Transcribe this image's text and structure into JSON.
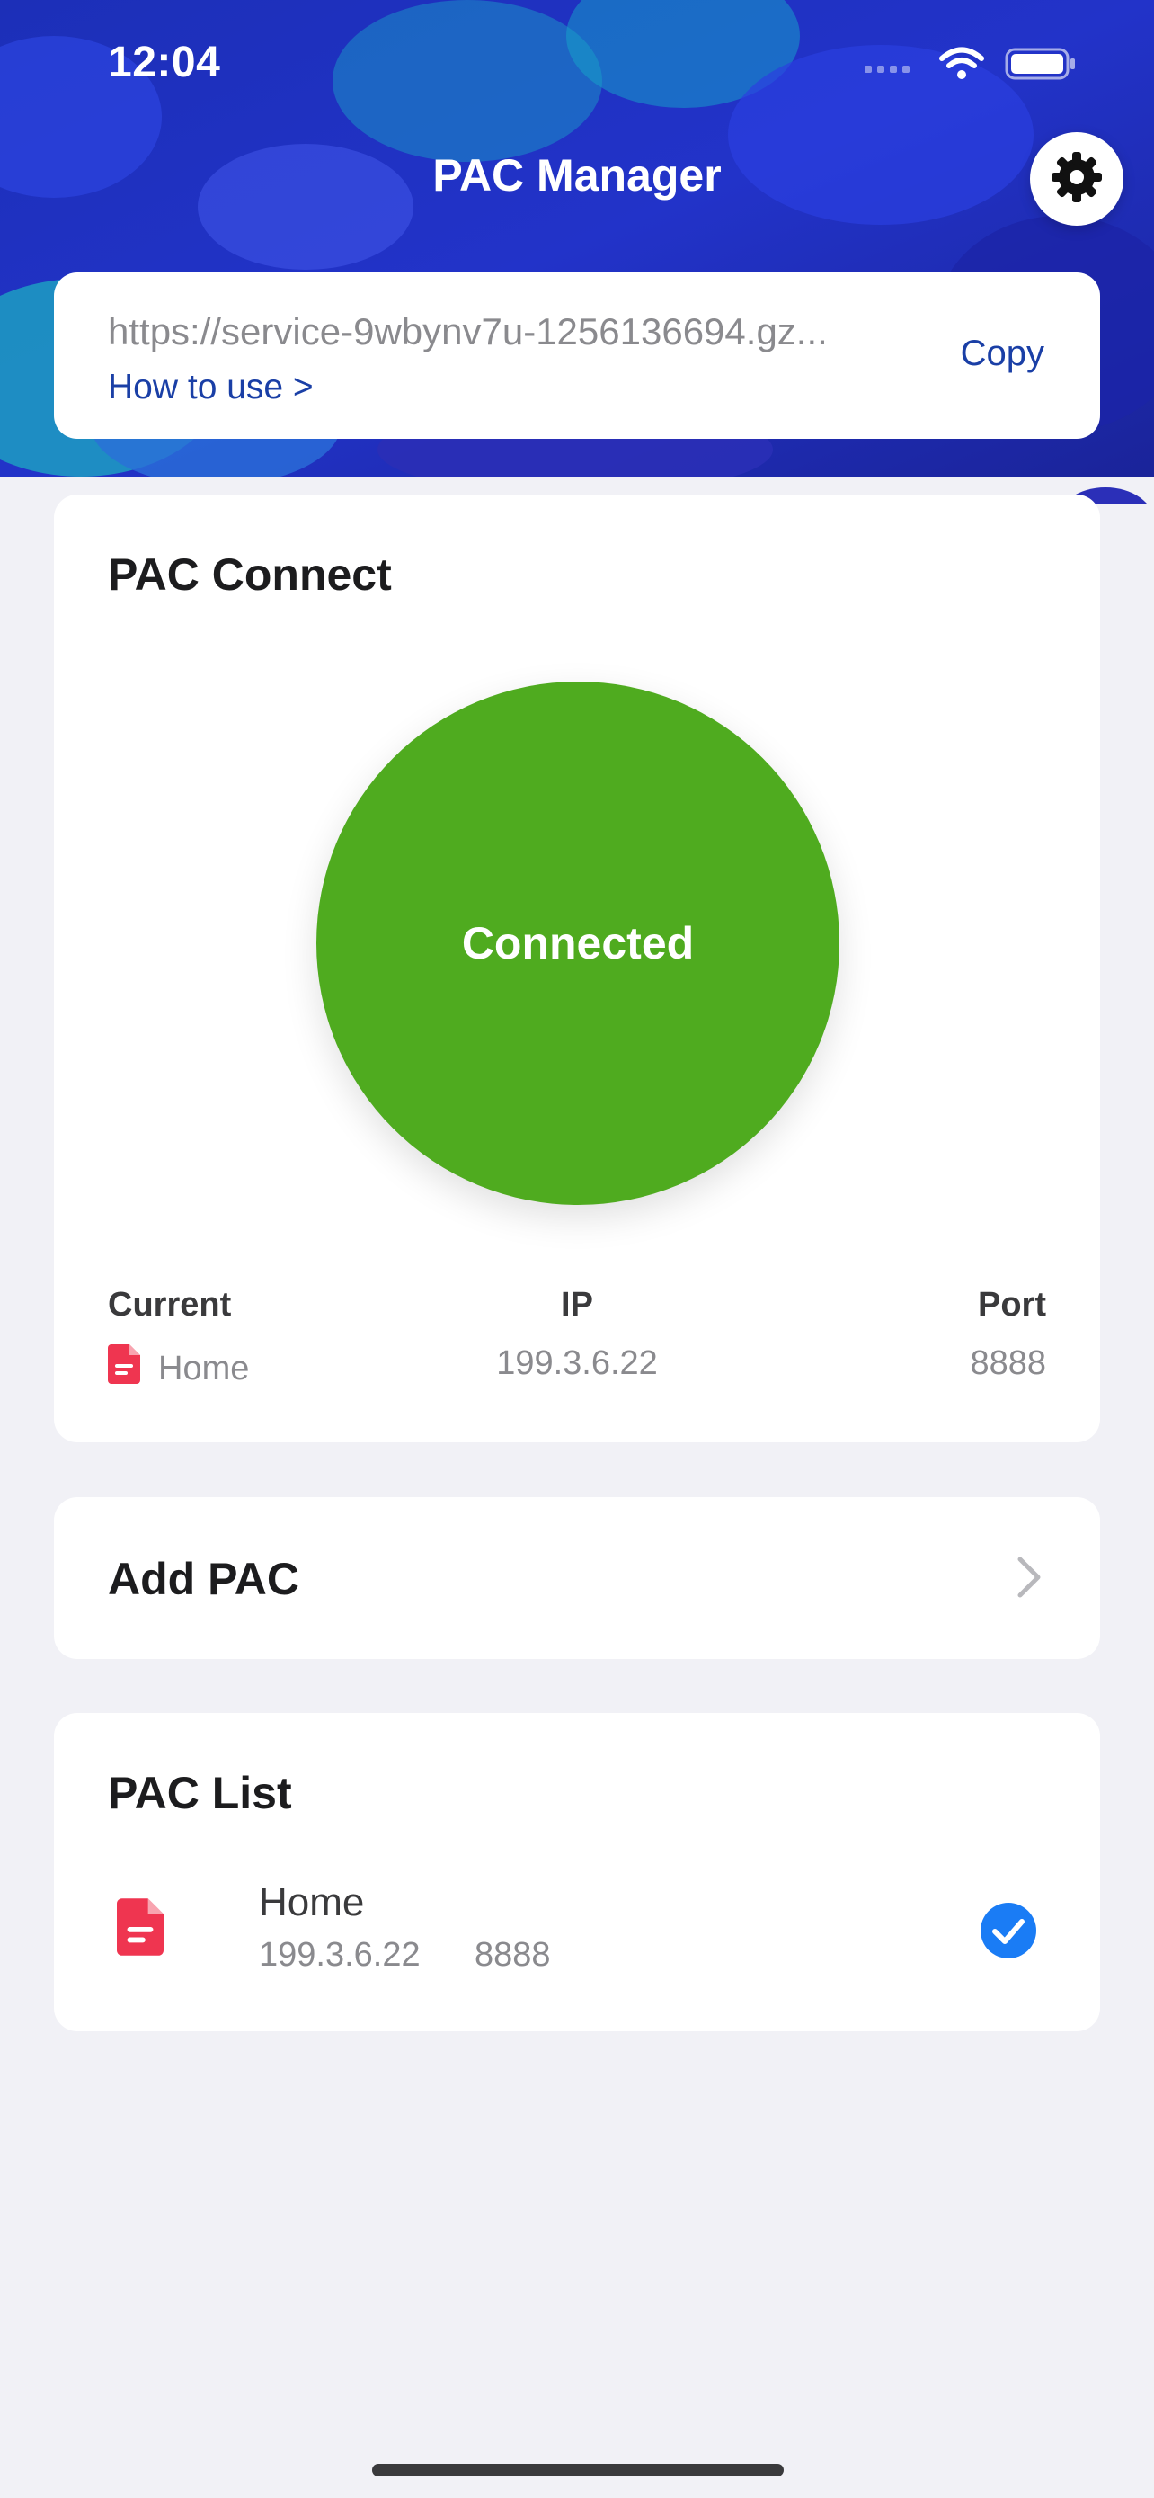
{
  "status_bar": {
    "time": "12:04"
  },
  "nav": {
    "title": "PAC Manager"
  },
  "url_card": {
    "url": "https://service-9wbynv7u-1256136694.gz...",
    "how_to": "How to use >",
    "copy_label": "Copy"
  },
  "connect_card": {
    "title": "PAC Connect",
    "status": "Connected",
    "status_color": "#4fab1f",
    "labels": {
      "current": "Current",
      "ip": "IP",
      "port": "Port"
    },
    "values": {
      "current": "Home",
      "ip": "199.3.6.22",
      "port": "8888"
    }
  },
  "add_card": {
    "label": "Add PAC"
  },
  "pac_list": {
    "title": "PAC List",
    "items": [
      {
        "name": "Home",
        "ip": "199.3.6.22",
        "port": "8888",
        "selected": true
      }
    ]
  },
  "colors": {
    "accent_link": "#1a3fa6",
    "file_icon": "#ef3550",
    "check": "#1a7cf5",
    "background": "#f1f1f6"
  }
}
